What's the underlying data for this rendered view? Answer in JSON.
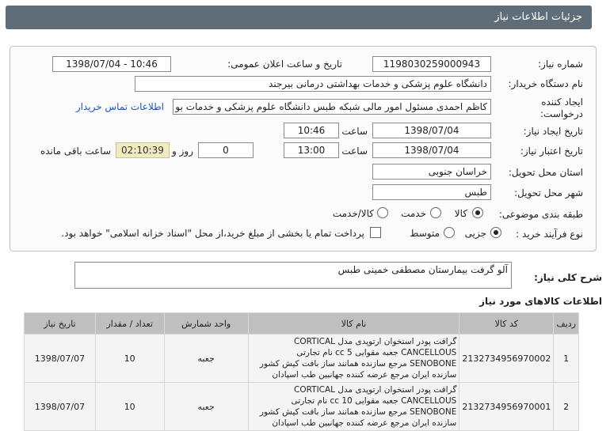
{
  "header": {
    "title": "جزئیات اطلاعات نیاز"
  },
  "form": {
    "need_number_label": "شماره نیاز:",
    "need_number": "1198030259000943",
    "announce_label": "تاریخ و ساعت اعلان عمومی:",
    "announce_value": "1398/07/04 - 10:46",
    "buyer_label": "نام دستگاه خریدار:",
    "buyer_value": "دانشگاه علوم پزشکی و خدمات بهداشتی درمانی بیرجند",
    "creator_label_1": "ایجاد کننده",
    "creator_label_2": "درخواست:",
    "creator_value": "کاظم احمدی مسئول امور مالی شبکه طبس دانشگاه علوم پزشکی و خدمات بو",
    "contact_link": "اطلاعات تماس خریدار",
    "created_date_label": "تاریخ ایجاد نیاز:",
    "created_date": "1398/07/04",
    "time_label": "ساعت",
    "created_time": "10:46",
    "valid_date_label": "تاریخ اعتبار نیاز:",
    "valid_date": "1398/07/04",
    "valid_time": "13:00",
    "day_value": "0",
    "day_and": "روز و",
    "countdown": "02:10:39",
    "remaining_label": "ساعت باقی مانده",
    "province_label": "استان محل تحویل:",
    "province": "خراسان جنوبی",
    "city_label": "شهر محل تحویل:",
    "city": "طبس",
    "category_label": "طبقه بندی موضوعی:",
    "category_options": [
      "کالا",
      "خدمت",
      "کالا/خدمت"
    ],
    "process_label": "نوع فرآیند خرید :",
    "process_options": [
      "جزیی",
      "متوسط"
    ],
    "payment_note": "پرداخت تمام یا بخشی از مبلغ خرید،از محل \"اسناد خزانه اسلامی\" خواهد بود."
  },
  "description": {
    "label": "شرح کلی نیاز:",
    "value": "آلو گرفت بیمارستان مصطفی خمینی طبس"
  },
  "items": {
    "title": "اطلاعات کالاهای مورد نیاز",
    "headers": [
      "ردیف",
      "کد کالا",
      "نام کالا",
      "واحد شمارش",
      "تعداد / مقدار",
      "تاریخ نیاز"
    ],
    "rows": [
      {
        "row": "1",
        "code": "2132734956970002",
        "name": "گرافت پودر استخوان ارتوپدی مدل CORTICAL CANCELLOUS جعبه مقوایی 5 cc نام تجارتی SENOBONE مرجع سازنده همانند ساز بافت کیش کشور سازنده ایران مرجع عرضه کننده جهانبین طب اسپادان",
        "unit": "جعبه",
        "qty": "10",
        "date": "1398/07/07"
      },
      {
        "row": "2",
        "code": "2132734956970001",
        "name": "گرافت پودر استخوان ارتوپدی مدل CORTICAL CANCELLOUS جعبه مقوایی 10 cc نام تجارتی SENOBONE مرجع سازنده همانند ساز بافت کیش کشور سازنده ایران مرجع عرضه کننده جهانبین طب اسپادان",
        "unit": "جعبه",
        "qty": "10",
        "date": "1398/07/07"
      }
    ]
  }
}
